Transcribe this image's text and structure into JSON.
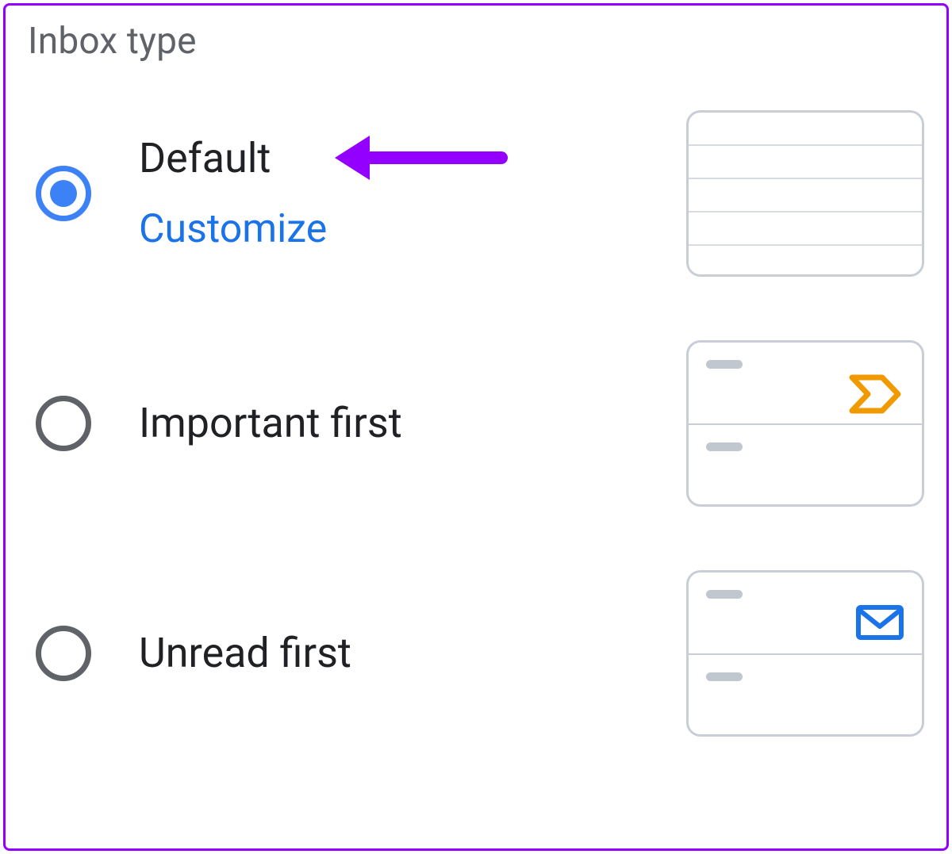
{
  "section_title": "Inbox type",
  "options": [
    {
      "label": "Default",
      "customize_label": "Customize",
      "selected": true
    },
    {
      "label": "Important first",
      "selected": false
    },
    {
      "label": "Unread first",
      "selected": false
    }
  ],
  "colors": {
    "accent": "#1a73e8",
    "radio_selected": "#3c82f6",
    "annotation": "#9300ff",
    "important_marker": "#f09a00",
    "border": "#c9ced6"
  }
}
